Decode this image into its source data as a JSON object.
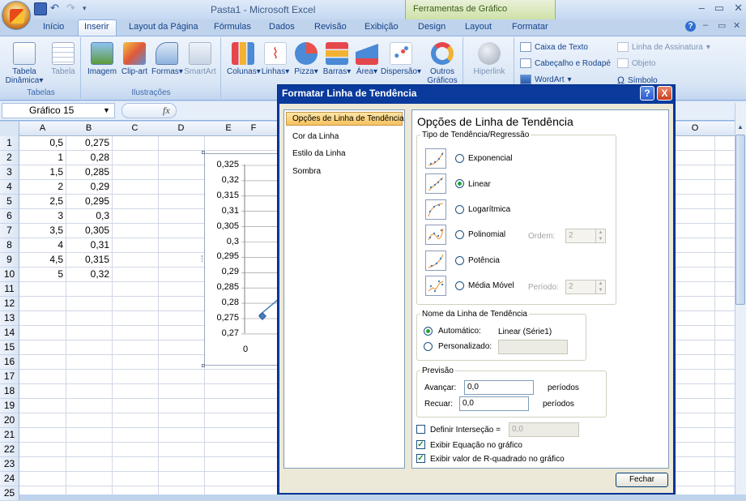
{
  "app": {
    "title": "Pasta1 - Microsoft Excel",
    "context_tools": "Ferramentas de Gráfico"
  },
  "tabs": [
    "Início",
    "Inserir",
    "Layout da Página",
    "Fórmulas",
    "Dados",
    "Revisão",
    "Exibição",
    "Design",
    "Layout",
    "Formatar"
  ],
  "ribbon": {
    "tabelas": {
      "label": "Tabelas",
      "items": [
        "Tabela\nDinâmica",
        "Tabela"
      ]
    },
    "ilustracoes": {
      "label": "Ilustrações",
      "items": [
        "Imagem",
        "Clip-art",
        "Formas",
        "SmartArt"
      ]
    },
    "graficos": {
      "items": [
        "Colunas",
        "Linhas",
        "Pizza",
        "Barras",
        "Área",
        "Dispersão",
        "Outros\nGráficos"
      ]
    },
    "links": {
      "items": [
        "Hiperlink"
      ]
    },
    "texto": {
      "items": [
        "Caixa de Texto",
        "Cabeçalho e Rodapé",
        "WordArt",
        "Linha de Assinatura",
        "Objeto",
        "Símbolo"
      ]
    }
  },
  "formula_bar": {
    "name_box": "Gráfico 15",
    "fx": "fx"
  },
  "columns": [
    "A",
    "B",
    "C",
    "D",
    "E",
    "F",
    "O"
  ],
  "rows": [
    "1",
    "2",
    "3",
    "4",
    "5",
    "6",
    "7",
    "8",
    "9",
    "10",
    "11",
    "12",
    "13",
    "14",
    "15",
    "16",
    "17",
    "18",
    "19",
    "20",
    "21",
    "22",
    "23",
    "24",
    "25"
  ],
  "cells": {
    "A": [
      "0,5",
      "1",
      "1,5",
      "2",
      "2,5",
      "3",
      "3,5",
      "4",
      "4,5",
      "5"
    ],
    "B": [
      "0,275",
      "0,28",
      "0,285",
      "0,29",
      "0,295",
      "0,3",
      "0,305",
      "0,31",
      "0,315",
      "0,32"
    ]
  },
  "chart": {
    "yticks": [
      "0,325",
      "0,32",
      "0,315",
      "0,31",
      "0,305",
      "0,3",
      "0,295",
      "0,29",
      "0,285",
      "0,28",
      "0,275",
      "0,27"
    ],
    "xtick": "0"
  },
  "dialog": {
    "title": "Formatar Linha de Tendência",
    "help": "?",
    "close": "X",
    "nav": [
      "Opções de Linha de Tendência",
      "Cor da Linha",
      "Estilo da Linha",
      "Sombra"
    ],
    "panel_title": "Opções de Linha de Tendência",
    "type_group": "Tipo de Tendência/Regressão",
    "types": [
      "Exponencial",
      "Linear",
      "Logarítmica",
      "Polinomial",
      "Potência",
      "Média Móvel"
    ],
    "ordem_label": "Ordem:",
    "ordem_value": "2",
    "periodo_label": "Período:",
    "periodo_value": "2",
    "name_group": "Nome da Linha de Tendência",
    "auto_label": "Automático:",
    "auto_value": "Linear (Série1)",
    "custom_label": "Personalizado:",
    "forecast_group": "Previsão",
    "avancar_label": "Avançar:",
    "avancar_value": "0,0",
    "recuar_label": "Recuar:",
    "recuar_value": "0,0",
    "periodos": "períodos",
    "intercept_label": "Definir Interseção =",
    "intercept_value": "0,0",
    "show_eq": "Exibir Equação no gráfico",
    "show_r2": "Exibir valor de R-quadrado no gráfico",
    "close_btn": "Fechar"
  }
}
